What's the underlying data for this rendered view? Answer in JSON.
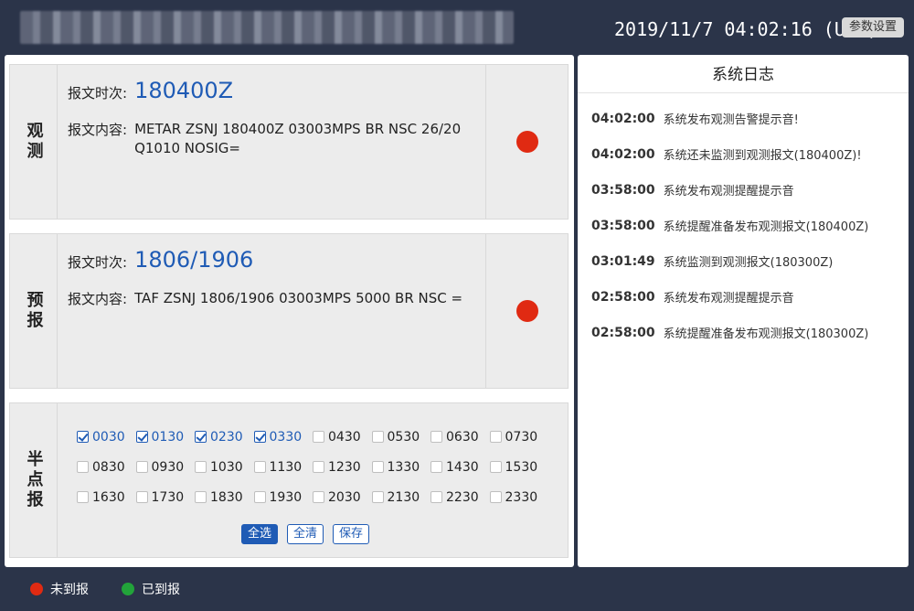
{
  "header": {
    "clock": "2019/11/7 04:02:16 (UTC)",
    "settings_label": "参数设置"
  },
  "observe": {
    "label": "观测",
    "time_label": "报文时次:",
    "time_value": "180400Z",
    "content_label": "报文内容:",
    "content_value": "METAR ZSNJ 180400Z 03003MPS BR NSC 26/20 Q1010 NOSIG=",
    "status": "未到报"
  },
  "forecast": {
    "label": "预报",
    "time_label": "报文时次:",
    "time_value": "1806/1906",
    "content_label": "报文内容:",
    "content_value": "TAF ZSNJ 1806/1906 03003MPS 5000 BR NSC =",
    "status": "未到报"
  },
  "halfhour": {
    "label": "半点报",
    "items": [
      {
        "time": "0030",
        "checked": true
      },
      {
        "time": "0130",
        "checked": true
      },
      {
        "time": "0230",
        "checked": true
      },
      {
        "time": "0330",
        "checked": true
      },
      {
        "time": "0430",
        "checked": false
      },
      {
        "time": "0530",
        "checked": false
      },
      {
        "time": "0630",
        "checked": false
      },
      {
        "time": "0730",
        "checked": false
      },
      {
        "time": "0830",
        "checked": false
      },
      {
        "time": "0930",
        "checked": false
      },
      {
        "time": "1030",
        "checked": false
      },
      {
        "time": "1130",
        "checked": false
      },
      {
        "time": "1230",
        "checked": false
      },
      {
        "time": "1330",
        "checked": false
      },
      {
        "time": "1430",
        "checked": false
      },
      {
        "time": "1530",
        "checked": false
      },
      {
        "time": "1630",
        "checked": false
      },
      {
        "time": "1730",
        "checked": false
      },
      {
        "time": "1830",
        "checked": false
      },
      {
        "time": "1930",
        "checked": false
      },
      {
        "time": "2030",
        "checked": false
      },
      {
        "time": "2130",
        "checked": false
      },
      {
        "time": "2230",
        "checked": false
      },
      {
        "time": "2330",
        "checked": false
      }
    ],
    "select_all": "全选",
    "clear_all": "全清",
    "save": "保存"
  },
  "log": {
    "title": "系统日志",
    "entries": [
      {
        "time": "04:02:00",
        "text": "系统发布观测告警提示音!"
      },
      {
        "time": "04:02:00",
        "text": "系统还未监测到观测报文(180400Z)!"
      },
      {
        "time": "03:58:00",
        "text": "系统发布观测提醒提示音"
      },
      {
        "time": "03:58:00",
        "text": "系统提醒准备发布观测报文(180400Z)"
      },
      {
        "time": "03:01:49",
        "text": "系统监测到观测报文(180300Z)"
      },
      {
        "time": "02:58:00",
        "text": "系统发布观测提醒提示音"
      },
      {
        "time": "02:58:00",
        "text": "系统提醒准备发布观测报文(180300Z)"
      }
    ]
  },
  "legend": {
    "not_arrived": "未到报",
    "not_arrived_color": "#e02a12",
    "arrived": "已到报",
    "arrived_color": "#22a33a"
  }
}
